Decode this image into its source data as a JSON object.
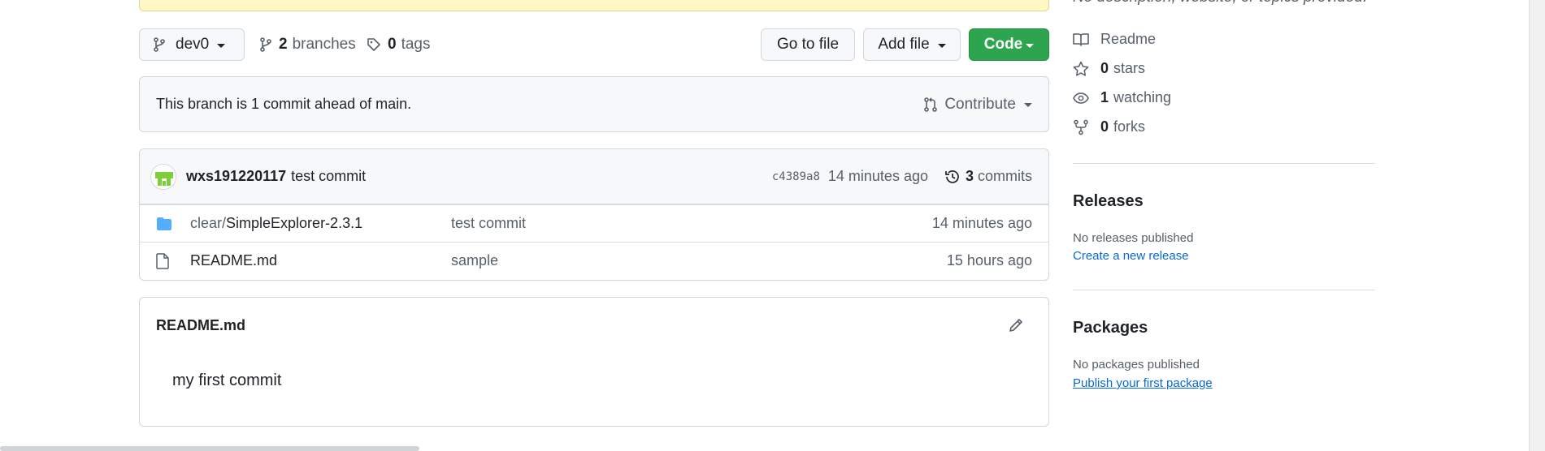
{
  "toolbar": {
    "branch": "dev0",
    "branches_count": "2",
    "branches_label": "branches",
    "tags_count": "0",
    "tags_label": "tags",
    "go_to_file": "Go to file",
    "add_file": "Add file",
    "code": "Code"
  },
  "ahead": {
    "message": "This branch is 1 commit ahead of main.",
    "contribute": "Contribute"
  },
  "latest_commit": {
    "author": "wxs191220117",
    "message": "test commit",
    "sha": "c4389a8",
    "time": "14 minutes ago",
    "commits_count": "3",
    "commits_label": "commits"
  },
  "files": [
    {
      "type": "folder",
      "name_prefix": "clear/",
      "name": "SimpleExplorer-2.3.1",
      "message": "test commit",
      "time": "14 minutes ago"
    },
    {
      "type": "file",
      "name_prefix": "",
      "name": "README.md",
      "message": "sample",
      "time": "15 hours ago"
    }
  ],
  "readme": {
    "title": "README.md",
    "body": "my first commit"
  },
  "sidebar": {
    "description": "No description, website, or topics provided.",
    "readme": "Readme",
    "stars_count": "0",
    "stars_label": "stars",
    "watching_count": "1",
    "watching_label": "watching",
    "forks_count": "0",
    "forks_label": "forks",
    "releases_title": "Releases",
    "releases_empty": "No releases published",
    "releases_link": "Create a new release",
    "packages_title": "Packages",
    "packages_empty": "No packages published",
    "packages_link": "Publish your first package"
  },
  "colors": {
    "code_button": "#2da44e",
    "link": "#0969da",
    "folder": "#54aeff",
    "banner": "#fff8c5"
  }
}
